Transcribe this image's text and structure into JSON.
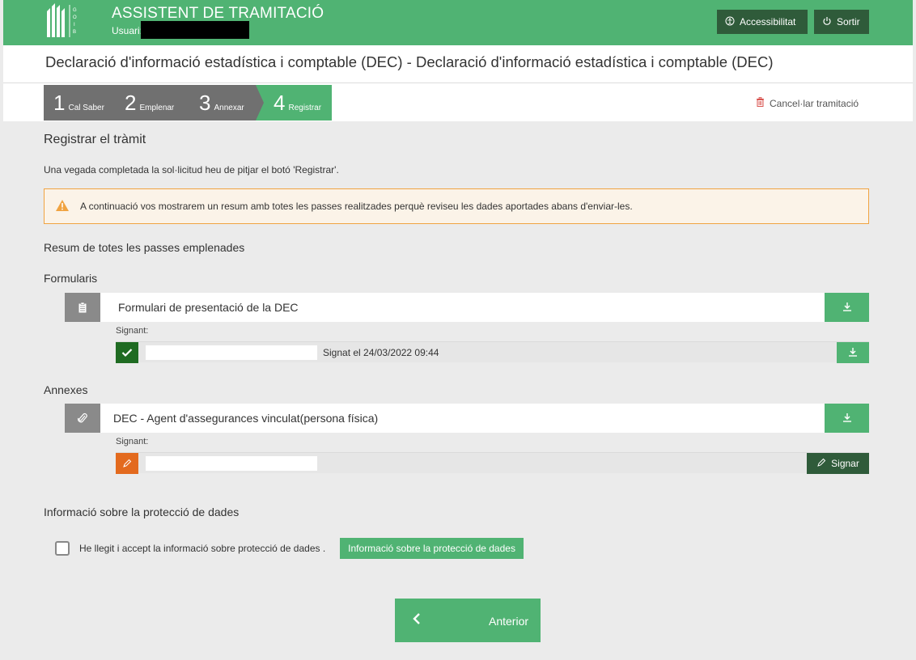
{
  "header": {
    "app_title": "ASSISTENT DE TRAMITACIÓ",
    "user_label": "Usuari:",
    "accessibility_label": "Accessibilitat",
    "exit_label": "Sortir",
    "logo_text": "GOIB"
  },
  "page_title": "Declaració d'informació estadística i comptable (DEC) - Declaració d'informació estadística i comptable (DEC)",
  "steps": [
    {
      "number": "1",
      "label": "Cal Saber"
    },
    {
      "number": "2",
      "label": "Emplenar"
    },
    {
      "number": "3",
      "label": "Annexar"
    },
    {
      "number": "4",
      "label": "Registrar"
    }
  ],
  "cancel_label": "Cancel·lar tramitació",
  "section": {
    "title": "Registrar el tràmit",
    "intro": "Una vegada completada la sol·licitud heu de pitjar el botó 'Registrar'.",
    "warning": "A continuació vos mostrarem un resum amb totes les passes realitzades perquè reviseu les dades aportades abans d'enviar-les.",
    "summary_title": "Resum de totes les passes emplenades"
  },
  "forms": {
    "title": "Formularis",
    "item_name": "Formulari de presentació de la DEC",
    "signant_label": "Signant:",
    "signed_text": "Signat el 24/03/2022 09:44"
  },
  "annexes": {
    "title": "Annexes",
    "item_name": "DEC - Agent d'assegurances vinculat(persona física)",
    "signant_label": "Signant:",
    "sign_button": "Signar"
  },
  "privacy": {
    "title": "Informació sobre la protecció de dades",
    "accept_label": "He llegit i accept la informació sobre protecció de dades .",
    "info_button": "Informació sobre la protecció de dades",
    "accepted": false
  },
  "nav": {
    "previous_label": "Anterior"
  },
  "colors": {
    "brand_green": "#50b373",
    "dark_green": "#2f5b3a",
    "step_gray": "#707070",
    "warning_orange": "#f0a341",
    "signed_green": "#1f6b22",
    "pending_orange": "#e36a1e"
  }
}
